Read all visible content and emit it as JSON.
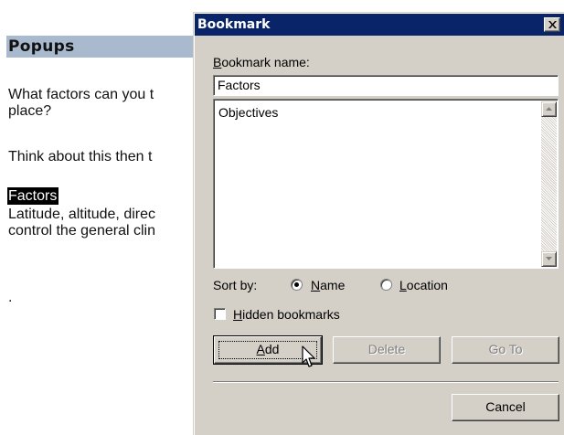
{
  "document": {
    "heading": "Popups",
    "lines": [
      "What factors can you t",
      "place?",
      "Think about this then t",
      "Latitude, altitude, direc",
      "control the general clin",
      "."
    ],
    "selected_text": "Factors",
    "heading_color": "#a9b9ce"
  },
  "dialog": {
    "title": "Bookmark",
    "titlebar_color": "#0a246a",
    "close_icon": "close-icon",
    "bookmark_name_label": {
      "prefix": "",
      "mnemonic": "B",
      "rest": "ookmark name:"
    },
    "bookmark_name_value": "Factors",
    "list_items": [
      "Objectives"
    ],
    "sort_by_label": "Sort by:",
    "sort_options": [
      {
        "mnemonic": "N",
        "rest": "ame",
        "selected": true
      },
      {
        "mnemonic": "L",
        "rest": "ocation",
        "selected": false
      }
    ],
    "hidden_bookmarks": {
      "mnemonic": "H",
      "rest": "idden bookmarks",
      "checked": false
    },
    "buttons": {
      "add": {
        "mnemonic": "A",
        "rest": "dd"
      },
      "delete": "Delete",
      "goto": "Go To",
      "cancel": "Cancel"
    }
  }
}
